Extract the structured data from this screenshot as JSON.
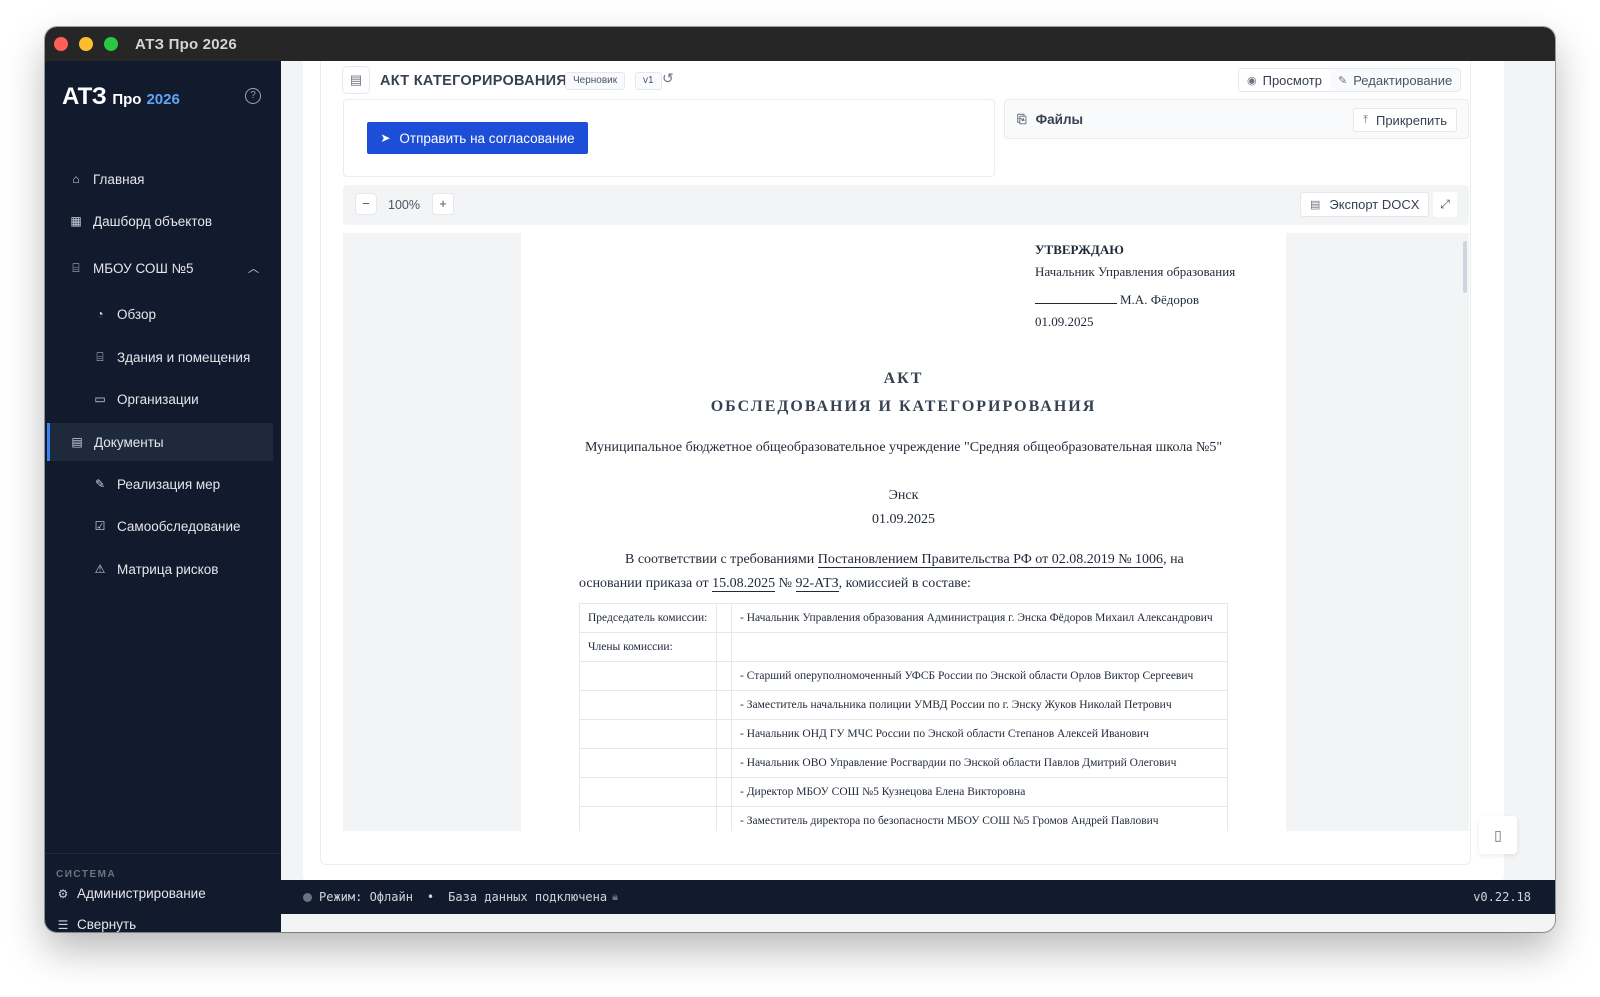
{
  "window": {
    "title": "АТЗ Про 2026"
  },
  "sidebar": {
    "logo": {
      "main": "АТЗ",
      "pro": "Про",
      "year": "2026"
    },
    "items": [
      {
        "label": "Главная",
        "icon": "home-icon"
      },
      {
        "label": "Дашборд объектов",
        "icon": "grid-icon"
      },
      {
        "label": "МБОУ СОШ №5",
        "icon": "building-icon"
      },
      {
        "label": "Обзор",
        "icon": "gauge-icon"
      },
      {
        "label": "Здания и помещения",
        "icon": "building-icon"
      },
      {
        "label": "Организации",
        "icon": "id-card-icon"
      },
      {
        "label": "Документы",
        "icon": "document-icon"
      },
      {
        "label": "Реализация мер",
        "icon": "wrench-icon"
      },
      {
        "label": "Самообследование",
        "icon": "checklist-icon"
      },
      {
        "label": "Матрица рисков",
        "icon": "warning-icon"
      }
    ],
    "system_label": "СИСТЕМА",
    "admin_label": "Администрирование",
    "collapse_label": "Свернуть"
  },
  "document": {
    "title": "АКТ КАТЕГОРИРОВАНИЯ",
    "status_badge": "Черновик",
    "version_badge": "v1",
    "view_mode": "Просмотр",
    "edit_mode": "Редактирование",
    "send_button": "Отправить на согласование",
    "files_title": "Файлы",
    "attach_button": "Прикрепить",
    "zoom": "100%",
    "export_button": "Экспорт DOCX"
  },
  "page": {
    "approve_heading": "УТВЕРЖДАЮ",
    "approve_position": "Начальник Управления образования",
    "approve_name": "М.А. Фёдоров",
    "approve_date": "01.09.2025",
    "title_line1": "АКТ",
    "title_line2": "ОБСЛЕДОВАНИЯ И КАТЕГОРИРОВАНИЯ",
    "organization": "Муниципальное бюджетное общеобразовательное учреждение \"Средняя общеобразовательная школа №5\"",
    "city": "Энск",
    "date": "01.09.2025",
    "para_prefix": "В соответствии с требованиями ",
    "para_link1": "Постановлением Правительства РФ от 02.08.2019 № 1006",
    "para_mid": ", на основании приказа от ",
    "para_link2": "15.08.2025",
    "para_no": " № ",
    "para_link3": "92-АТЗ",
    "para_suffix": ", комиссией в составе:",
    "commission": [
      {
        "role": "Председатель комиссии:",
        "member": "- Начальник Управления образования Администрация г. Энска Фёдоров Михаил Александрович"
      },
      {
        "role": "Члены комиссии:",
        "member": ""
      },
      {
        "role": "",
        "member": "- Старший оперуполномоченный УФСБ России по Энской области Орлов Виктор Сергеевич"
      },
      {
        "role": "",
        "member": "- Заместитель начальника полиции УМВД России по г. Энску Жуков Николай Петрович"
      },
      {
        "role": "",
        "member": "- Начальник ОНД ГУ МЧС России по Энской области Степанов Алексей Иванович"
      },
      {
        "role": "",
        "member": "- Начальник ОВО Управление Росгвардии по Энской области Павлов Дмитрий Олегович"
      },
      {
        "role": "",
        "member": "- Директор МБОУ СОШ №5 Кузнецова Елена Викторовна"
      },
      {
        "role": "",
        "member": "- Заместитель директора по безопасности МБОУ СОШ №5 Громов Андрей Павлович"
      }
    ]
  },
  "statusbar": {
    "mode": "Режим: Офлайн",
    "separator": "•",
    "db": "База данных подключена",
    "version": "v0.22.18"
  }
}
